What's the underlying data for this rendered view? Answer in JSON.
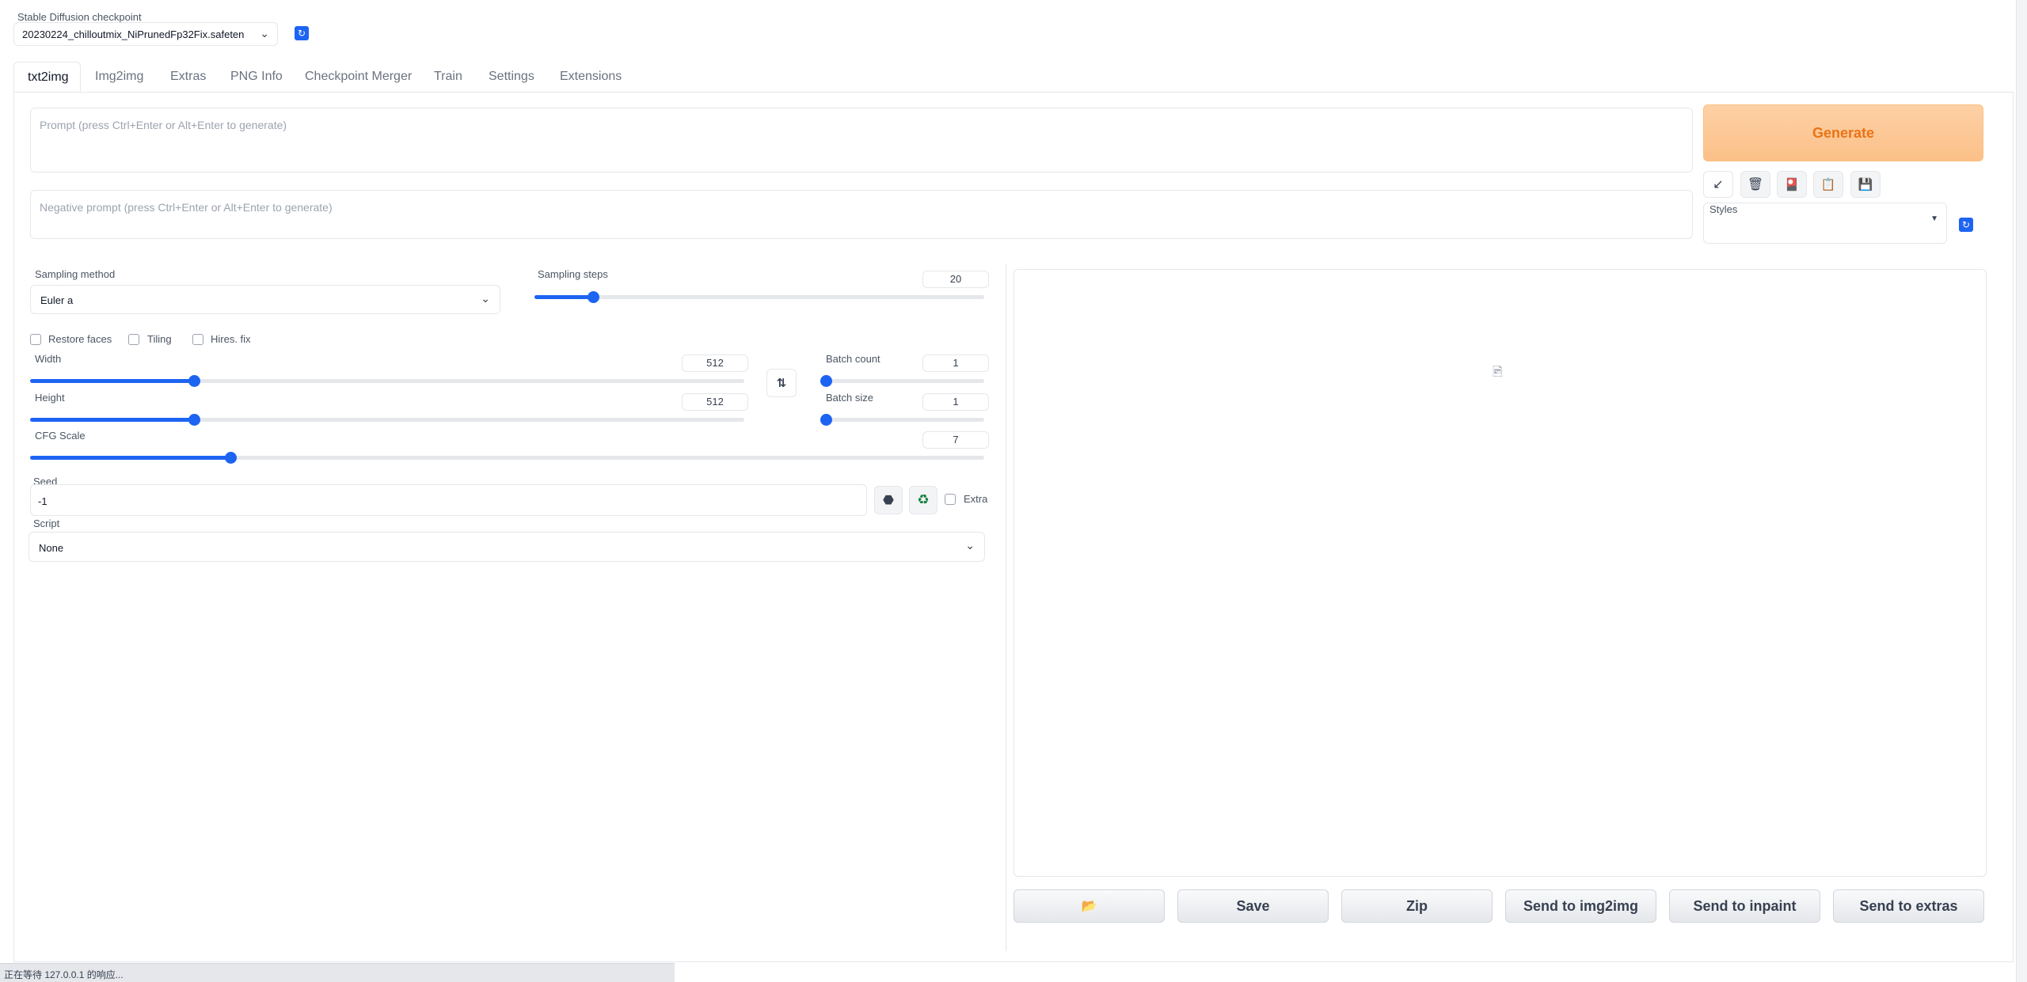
{
  "checkpoint": {
    "label": "Stable Diffusion checkpoint",
    "value": "20230224_chilloutmix_NiPrunedFp32Fix.safeten"
  },
  "tabs": [
    {
      "label": "txt2img",
      "active": true
    },
    {
      "label": "Img2img"
    },
    {
      "label": "Extras"
    },
    {
      "label": "PNG Info"
    },
    {
      "label": "Checkpoint Merger"
    },
    {
      "label": "Train"
    },
    {
      "label": "Settings"
    },
    {
      "label": "Extensions"
    }
  ],
  "prompt": {
    "placeholder": "Prompt (press Ctrl+Enter or Alt+Enter to generate)"
  },
  "negative_prompt": {
    "placeholder": "Negative prompt (press Ctrl+Enter or Alt+Enter to generate)"
  },
  "generate": {
    "label": "Generate"
  },
  "styles": {
    "label": "Styles"
  },
  "sampling": {
    "method_label": "Sampling method",
    "method_value": "Euler a",
    "steps_label": "Sampling steps",
    "steps_value": "20",
    "steps_fraction": 0.13
  },
  "options": {
    "restore_faces": "Restore faces",
    "tiling": "Tiling",
    "hires_fix": "Hires. fix"
  },
  "width": {
    "label": "Width",
    "value": "512",
    "fraction": 0.23
  },
  "height": {
    "label": "Height",
    "value": "512",
    "fraction": 0.23
  },
  "batch_count": {
    "label": "Batch count",
    "value": "1",
    "fraction": 0
  },
  "batch_size": {
    "label": "Batch size",
    "value": "1",
    "fraction": 0
  },
  "cfg": {
    "label": "CFG Scale",
    "value": "7",
    "fraction": 0.21
  },
  "seed": {
    "label": "Seed",
    "value": "-1",
    "extra_label": "Extra"
  },
  "script": {
    "label": "Script",
    "value": "None"
  },
  "output_buttons": {
    "save": "Save",
    "zip": "Zip",
    "send_img2img": "Send to img2img",
    "send_inpaint": "Send to inpaint",
    "send_extras": "Send to extras"
  },
  "status_bar": {
    "text": "正在等待 127.0.0.1 的响应..."
  },
  "colors": {
    "accent": "#1d64f2",
    "generate_bg": "#fdc590",
    "generate_text": "#ea7317"
  }
}
